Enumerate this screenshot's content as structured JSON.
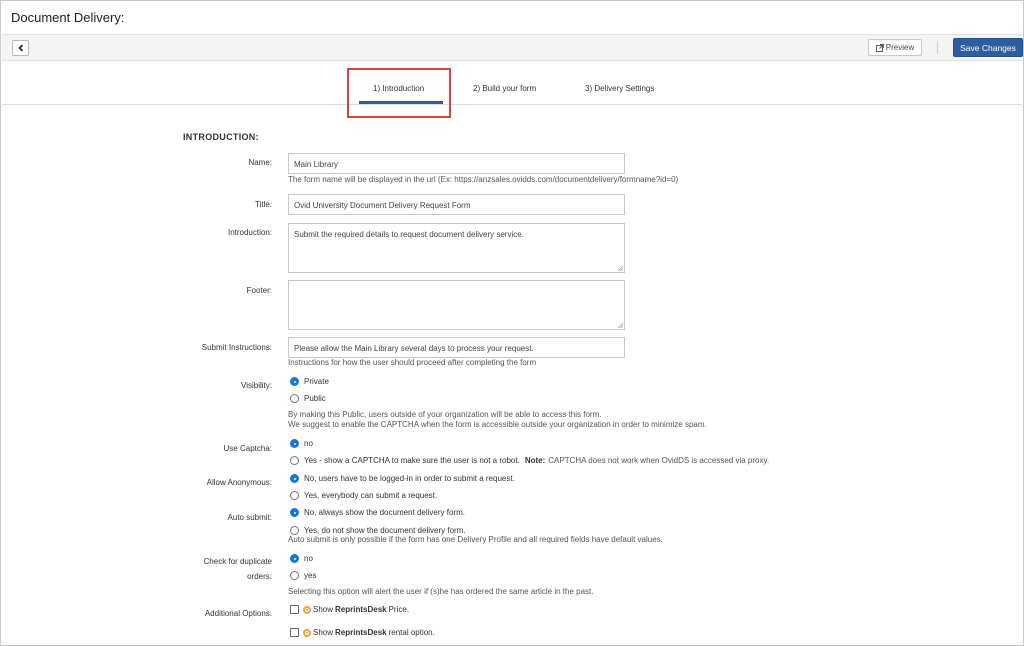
{
  "page": {
    "title": "Document Delivery:"
  },
  "toolbar": {
    "preview_label": "Preview",
    "save_label": "Save Changes"
  },
  "tabs": [
    {
      "label": "1)  Introduction",
      "active": true
    },
    {
      "label": "2)  Build your form",
      "active": false
    },
    {
      "label": "3)  Delivery Settings",
      "active": false
    }
  ],
  "colors": {
    "accent": "#2f5c9e",
    "highlight": "#e04040",
    "radio_selected": "#1a73e8"
  },
  "form": {
    "section_title": "INTRODUCTION:",
    "name": {
      "label": "Name:",
      "value": "Main Library",
      "help": "The form name will be displayed in the url (Ex: https://anzsales.ovidds.com/documentdelivery/formname?id=0)"
    },
    "title": {
      "label": "Title:",
      "value": "Ovid University Document Delivery Request Form"
    },
    "introduction": {
      "label": "Introduction:",
      "value": "Submit the required details to request document delivery service."
    },
    "footer": {
      "label": "Footer:",
      "value": ""
    },
    "submit_instructions": {
      "label": "Submit Instructions:",
      "value": "Please allow the Main Library several days to process your request.",
      "help": "Instructions for how the user should proceed after completing the form"
    },
    "visibility": {
      "label": "Visibility:",
      "options": [
        "Private",
        "Public"
      ],
      "selected": "Private",
      "help_line1": "By making this Public, users outside of your organization will be able to access this form.",
      "help_line2": "We suggest to enable the CAPTCHA when the form is accessible outside your organization in order to minimize spam."
    },
    "use_captcha": {
      "label": "Use Captcha:",
      "options": [
        "no",
        "Yes - show a CAPTCHA to make sure the user is not a robot."
      ],
      "note_label": "Note:",
      "note_text": "CAPTCHA does not work when OvidDS is accessed via proxy.",
      "selected": "no"
    },
    "allow_anonymous": {
      "label": "Allow Anonymous:",
      "options": [
        "No, users have to be logged-in in order to submit a request.",
        "Yes, everybody can submit a request."
      ],
      "selected": "No, users have to be logged-in in order to submit a request."
    },
    "auto_submit": {
      "label": "Auto submit:",
      "options": [
        "No, always show the document delivery form.",
        "Yes, do not show the document delivery form."
      ],
      "selected": "No, always show the document delivery form.",
      "help": "Auto submit is only possible if the form has one Delivery Profile and all required fields have default values."
    },
    "check_duplicates": {
      "label_line1": "Check for duplicate",
      "label_line2": "orders:",
      "options": [
        "no",
        "yes"
      ],
      "selected": "no",
      "help": "Selecting this option will alert the user if (s)he has ordered the same article in the past."
    },
    "additional_options": {
      "label": "Additional Options:",
      "items": [
        {
          "prefix": "Show",
          "brand": "ReprintsDesk",
          "suffix": "Price.",
          "checked": false
        },
        {
          "prefix": "Show",
          "brand": "ReprintsDesk",
          "suffix": "rental option.",
          "checked": false
        }
      ]
    }
  }
}
